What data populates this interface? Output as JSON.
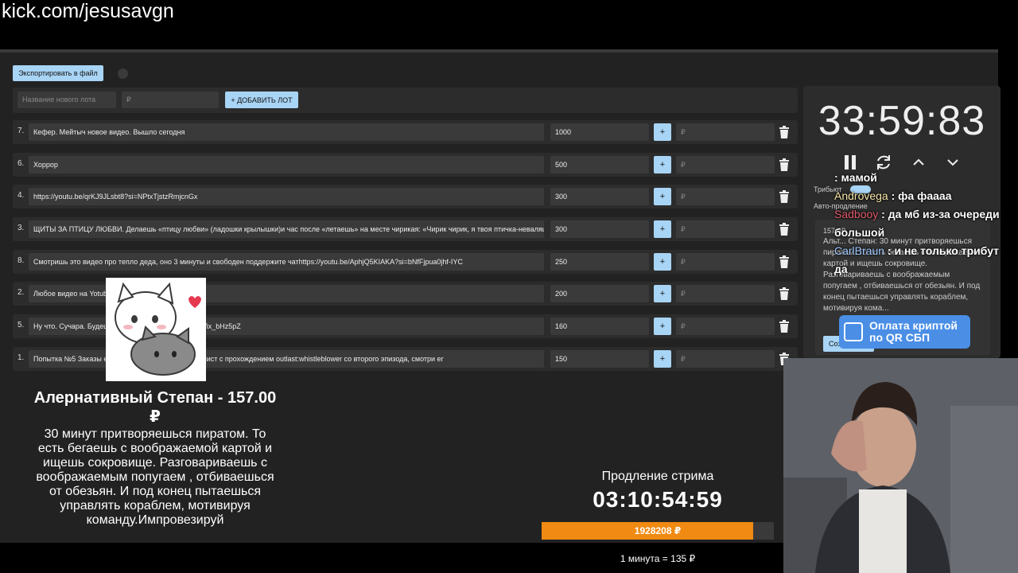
{
  "url": "kick.com/jesusavgn",
  "toolbar": {
    "export_label": "Экспортировать в файл"
  },
  "add_lot": {
    "name_placeholder": "Название нового лота",
    "price_placeholder": "₽",
    "add_label": "+ ДОБАВИТЬ ЛОТ"
  },
  "lots": [
    {
      "num": "7.",
      "title": "Кефер. Мейтыч новое видео. Вышло сегодня",
      "amount": "1000",
      "plus": "+",
      "rub": "₽"
    },
    {
      "num": "6.",
      "title": "Хоррор",
      "amount": "500",
      "plus": "+",
      "rub": "₽"
    },
    {
      "num": "4.",
      "title": "https://youtu.be/qrKJ9JLsbt8?si=NPtxTjstzRmjcnGx",
      "amount": "300",
      "plus": "+",
      "rub": "₽"
    },
    {
      "num": "3.",
      "title": "ЩИТЫ ЗА ПТИЦУ ЛЮБВИ. Делаешь «птицу любви» (ладошки крылышки)и час после «летаешь» на месте чирикая: «Чирик чирик, я твоя птичка-неваляш",
      "amount": "300",
      "plus": "+",
      "rub": "₽"
    },
    {
      "num": "8.",
      "title": "Смотришь это видео про тепло деда, оно 3 минуты и свободен поддержите чатhttps://youtu.be/AphjQ5KIAKA?si=bNfFjpua0jhf-IYC",
      "amount": "250",
      "plus": "+",
      "rub": "₽"
    },
    {
      "num": "2.",
      "title": "Любое видео на Yotub                              00",
      "amount": "200",
      "plus": "+",
      "rub": "₽"
    },
    {
      "num": "5.",
      "title": "Ну что. Сучара. Будеш                              be/eWrstRfalnw?si=9_PcXMVix_bHz5pZ",
      "amount": "160",
      "plus": "+",
      "rub": "₽"
    },
    {
      "num": "1.",
      "title": "Попытка №5 Заказы                              ек, включи свой старый плей-лист с прохождением outlast:whistleblower со второго эпизода, смотри ег",
      "amount": "150",
      "plus": "+",
      "rub": "₽"
    }
  ],
  "timer": {
    "value": "33:59:83"
  },
  "settings": {
    "tribute_label": "Трибьют",
    "auto_extend_label": "Авто-продление"
  },
  "info_card": {
    "price": "157.0₽",
    "desc": "Альт...          Степан: 30 минут притворяешься пиратом. То есть бегаешь с воображаемой картой и ищешь сокровище. Разговариваешь с воображаемым попугаем , отбиваешься от обезьян. И под конец пытаешься управлять кораблем, мотивируя кома...",
    "button": "Созд..."
  },
  "chat": [
    {
      "user": "",
      "text": ": мамой"
    },
    {
      "user": "Androvega",
      "text": ": фа фаааа"
    },
    {
      "user": "Sadbooy",
      "text": ": да мб из-за очереди большой"
    },
    {
      "user": "CarlBraun",
      "text": ": и не только трибут да"
    }
  ],
  "qr_banner": {
    "line1": "Оплата криптой",
    "line2": "по QR СБП"
  },
  "alert": {
    "title": "Алернативный Степан - 157.00 ₽",
    "desc": "30 минут притворяешься пиратом. То есть бегаешь с воображаемой картой и ищешь сокровище. Разговариваешь с воображаемым попугаем , отбиваешься от обезьян. И под конец пытаешься управлять кораблем, мотивируя команду.Импровезируй"
  },
  "extension": {
    "label": "Продление стрима",
    "timer": "03:10:54:59",
    "progress_text": "1928208 ₽",
    "progress_fraction": 0.91,
    "rate": "1 минута = 135 ₽"
  },
  "colors": {
    "accent": "#a8d4f5",
    "progress": "#f08a12",
    "chat_user_androvega": "#f5e6a8",
    "chat_user_sadbooy": "#e05a6a",
    "chat_user_carlbraun": "#9ec8ff"
  }
}
